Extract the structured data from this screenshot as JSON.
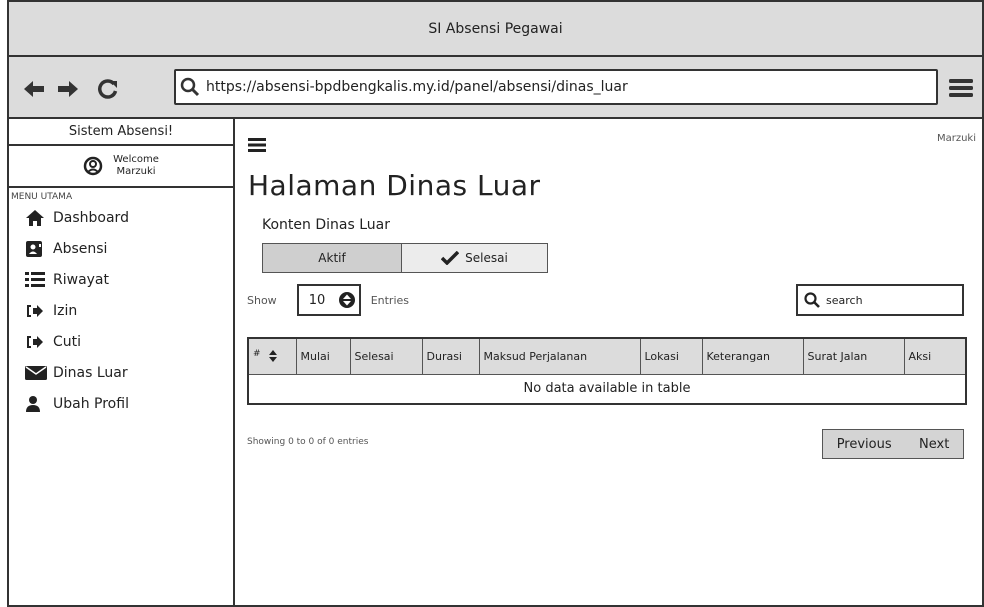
{
  "window": {
    "title": "SI Absensi Pegawai"
  },
  "browser": {
    "url": "https://absensi-bpdbengkalis.my.id/panel/absensi/dinas_luar"
  },
  "sidebar": {
    "brand": "Sistem Absensi!",
    "welcome": "Welcome",
    "username": "Marzuki",
    "menu_heading": "MENU UTAMA",
    "items": [
      {
        "label": "Dashboard",
        "icon": "home-icon"
      },
      {
        "label": "Absensi",
        "icon": "contact-card-icon"
      },
      {
        "label": "Riwayat",
        "icon": "list-icon"
      },
      {
        "label": "Izin",
        "icon": "sign-in-icon"
      },
      {
        "label": "Cuti",
        "icon": "sign-in-icon"
      },
      {
        "label": "Dinas Luar",
        "icon": "envelope-icon"
      },
      {
        "label": "Ubah Profil",
        "icon": "user-icon"
      }
    ]
  },
  "header": {
    "user": "Marzuki"
  },
  "main": {
    "title": "Halaman Dinas Luar",
    "subtitle": "Konten Dinas Luar",
    "tabs": [
      {
        "label": "Aktif"
      },
      {
        "label": "Selesai"
      }
    ],
    "show_label": "Show",
    "entries_value": "10",
    "entries_label": "Entries",
    "search_placeholder": "search",
    "table": {
      "columns": [
        "#",
        "Mulai",
        "Selesai",
        "Durasi",
        "Maksud Perjalanan",
        "Lokasi",
        "Keterangan",
        "Surat Jalan",
        "Aksi"
      ],
      "empty_text": "No data available in table"
    },
    "info_text": "Showing 0 to 0 of 0 entries",
    "pagination": {
      "previous": "Previous",
      "next": "Next"
    }
  }
}
